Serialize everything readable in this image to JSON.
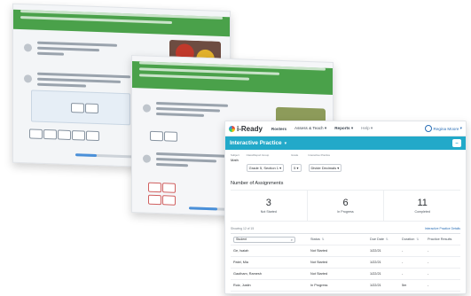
{
  "app": {
    "logo": "i-Ready"
  },
  "nav": {
    "items": [
      "Rosters",
      "Assess & Teach",
      "Reports",
      "Help"
    ],
    "user": "Regina Moore"
  },
  "page": {
    "title": "Interactive Practice"
  },
  "filters": [
    {
      "label": "Subject",
      "value": "Math"
    },
    {
      "label": "Class/Report Group",
      "value": "Grade 5, Section 1"
    },
    {
      "label": "Grade",
      "value": "5"
    },
    {
      "label": "Interactive Practice",
      "value": "Divide Decimals"
    }
  ],
  "assignments": {
    "title": "Number of Assignments",
    "stats": [
      {
        "value": "3",
        "label": "Not Started"
      },
      {
        "value": "6",
        "label": "In Progress"
      },
      {
        "value": "11",
        "label": "Completed"
      }
    ]
  },
  "table": {
    "showing": "Showing 12 of 15",
    "details_link": "Interactive Practice Details",
    "search_placeholder": "Student",
    "headers": [
      "Status",
      "Due Date",
      "Duration",
      "Practice Results"
    ],
    "rows": [
      {
        "student": "Ge, Isaiah",
        "status": "Not Started",
        "due": "1/22/21",
        "duration": "-",
        "results": "-"
      },
      {
        "student": "Patel, Mia",
        "status": "Not Started",
        "due": "1/22/21",
        "duration": "-",
        "results": "-"
      },
      {
        "student": "Gautham, Ramesh",
        "status": "Not Started",
        "due": "1/22/21",
        "duration": "-",
        "results": "-"
      },
      {
        "student": "Ruiz, Justin",
        "status": "In Progress",
        "due": "1/22/21",
        "duration": "5m",
        "results": "-"
      }
    ]
  }
}
